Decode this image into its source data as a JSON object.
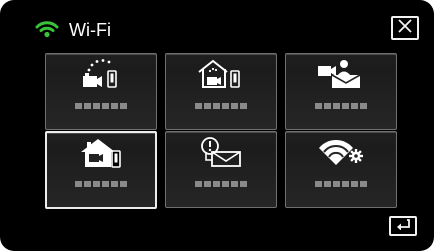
{
  "header": {
    "title": "Wi-Fi",
    "wifi_icon": "wifi-signal-icon",
    "close_icon": "close-icon"
  },
  "tiles": [
    {
      "name": "direct-monitoring",
      "icon": "direct-monitoring-icon",
      "label_placeholder": true
    },
    {
      "name": "indoor-monitoring",
      "icon": "home-camera-phone-icon",
      "label_placeholder": true
    },
    {
      "name": "mail-video",
      "icon": "camera-mail-icon",
      "label_placeholder": true
    },
    {
      "name": "visitor-notification",
      "icon": "home-visitor-icon",
      "label_placeholder": true
    },
    {
      "name": "mail-notification",
      "icon": "mail-alert-icon",
      "label_placeholder": true
    },
    {
      "name": "wifi-settings",
      "icon": "wifi-settings-icon",
      "label_placeholder": true
    }
  ],
  "footer": {
    "back_icon": "return-icon"
  },
  "colors": {
    "background": "#000000",
    "tile_border": "#707070",
    "selected_border": "#ececec",
    "wifi_icon": "#39c23a"
  }
}
